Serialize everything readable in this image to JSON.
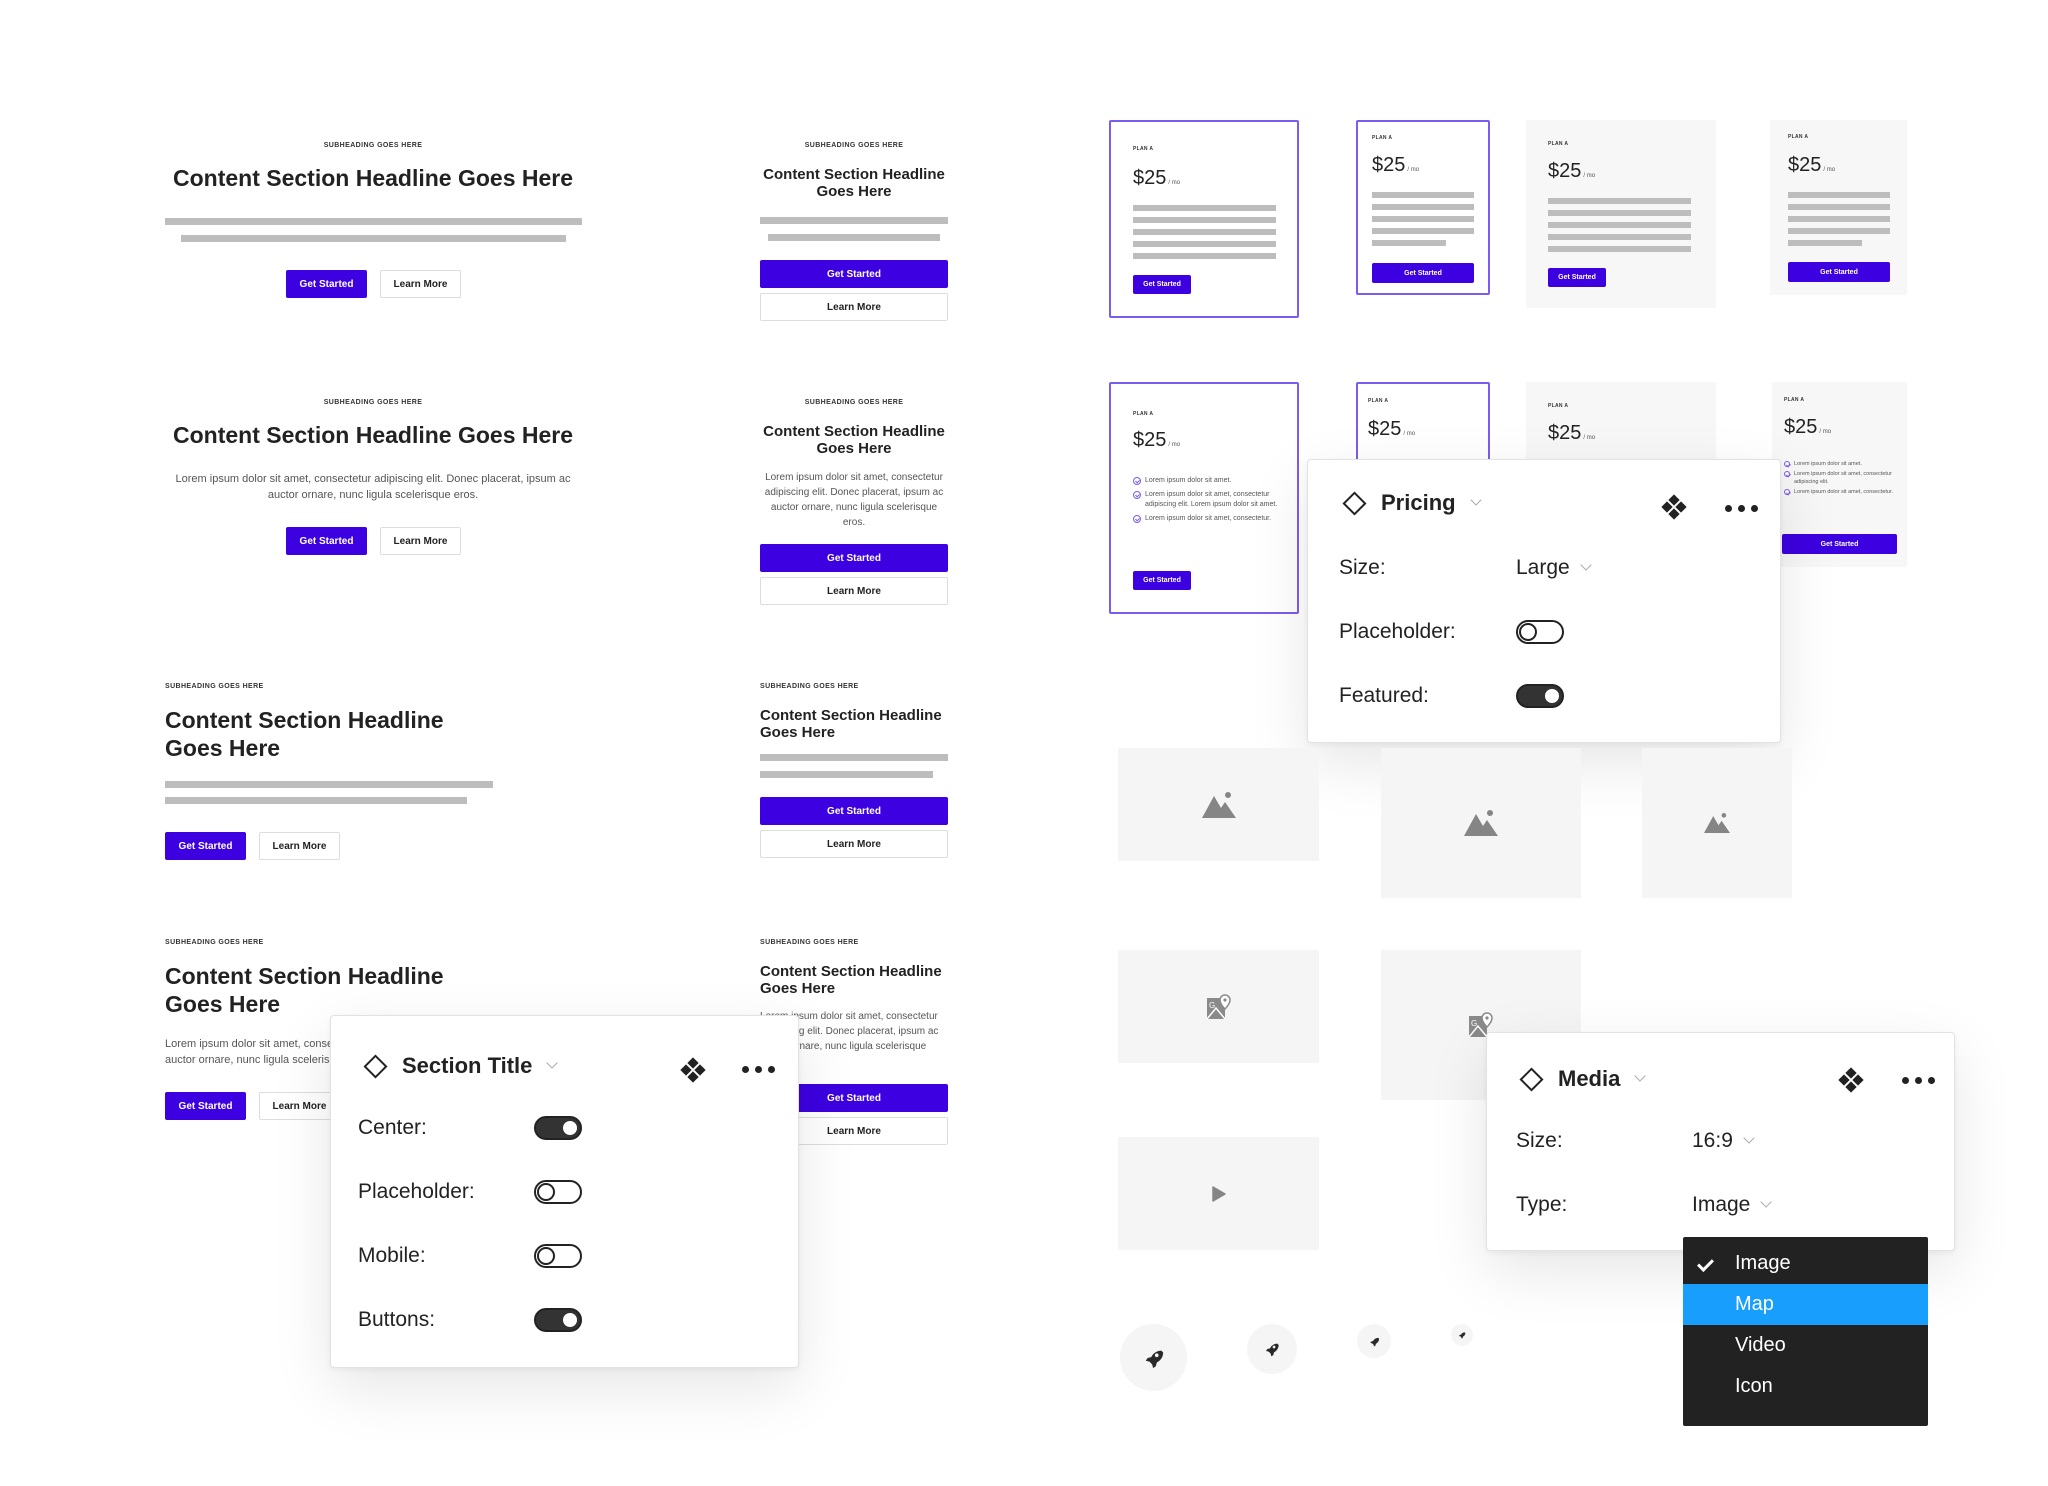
{
  "sections": [
    {
      "subheading": "SUBHEADING GOES HERE",
      "headline": "Content Section Headline Goes Here",
      "primary": "Get Started",
      "secondary": "Learn More",
      "body": "Lorem ipsum dolor sit amet, consectetur adipiscing elit. Donec placerat, ipsum ac auctor ornare, nunc ligula scelerisque eros."
    }
  ],
  "pricing_card": {
    "plan": "PLAN A",
    "price": "$25",
    "period": "/ mo",
    "cta": "Get Started",
    "features": [
      "Lorem ipsum dolor sit amet.",
      "Lorem ipsum dolor sit amet, consectetur adipiscing elit. Lorem ipsum dolor sit amet.",
      "Lorem ipsum dolor sit amet, consectetur."
    ],
    "features_narrow": [
      "Lorem ipsum dolor sit amet.",
      "Lorem ipsum dolor sit amet, consectetur adipiscing elit.",
      "Lorem ipsum dolor sit amet, consectetur."
    ]
  },
  "colors": {
    "primary": "#3d00e0",
    "featured_border": "#7b5cf0",
    "dropdown_bg": "#222222",
    "dropdown_highlight": "#189efc"
  },
  "pricing_panel": {
    "title": "Pricing",
    "props": [
      {
        "label": "Size:",
        "value": "Large"
      },
      {
        "label": "Placeholder:",
        "toggle": false
      },
      {
        "label": "Featured:",
        "toggle": true
      }
    ]
  },
  "section_panel": {
    "title": "Section Title",
    "props": [
      {
        "label": "Center:",
        "toggle": true
      },
      {
        "label": "Placeholder:",
        "toggle": false
      },
      {
        "label": "Mobile:",
        "toggle": false
      },
      {
        "label": "Buttons:",
        "toggle": true
      }
    ]
  },
  "media_panel": {
    "title": "Media",
    "props": [
      {
        "label": "Size:",
        "value": "16:9"
      },
      {
        "label": "Type:",
        "value": "Image"
      }
    ],
    "dropdown": {
      "options": [
        "Image",
        "Map",
        "Video",
        "Icon"
      ],
      "selected": "Image",
      "highlighted": "Map"
    }
  },
  "icons": {
    "image": "image-placeholder-icon",
    "map": "map-placeholder-icon",
    "video": "play-icon",
    "avatar": "rocket-icon"
  }
}
